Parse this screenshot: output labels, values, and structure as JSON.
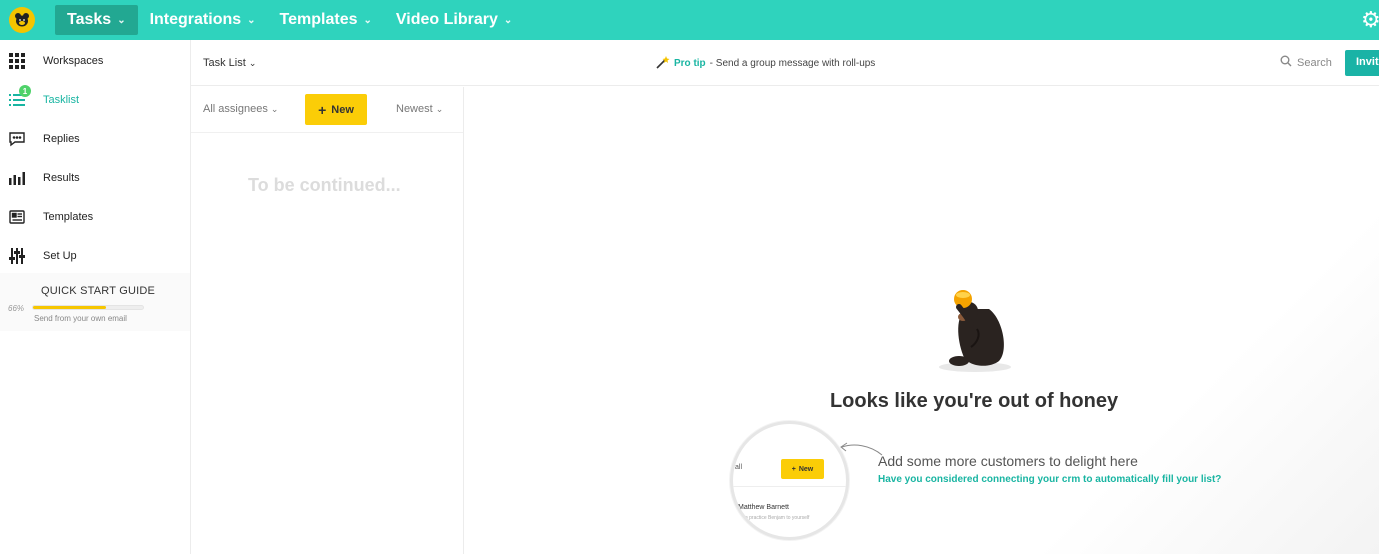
{
  "topbar": {
    "nav": [
      {
        "label": "Tasks",
        "active": true
      },
      {
        "label": "Integrations",
        "active": false
      },
      {
        "label": "Templates",
        "active": false
      },
      {
        "label": "Video Library",
        "active": false
      }
    ]
  },
  "sidebar": {
    "items": [
      {
        "label": "Workspaces",
        "icon": "grid-icon"
      },
      {
        "label": "Tasklist",
        "icon": "list-icon",
        "badge": "1",
        "active": true
      },
      {
        "label": "Replies",
        "icon": "chat-bubble-icon"
      },
      {
        "label": "Results",
        "icon": "bar-chart-icon"
      },
      {
        "label": "Templates",
        "icon": "template-card-icon"
      },
      {
        "label": "Set Up",
        "icon": "sliders-icon"
      }
    ],
    "quick_start": {
      "title": "QUICK START GUIDE",
      "percent_label": "66%",
      "progress": 0.66,
      "subtitle": "Send from your own email"
    }
  },
  "subbar": {
    "tasklist_label": "Task List",
    "protip_label": "Pro tip",
    "protip_text": "- Send a group message with roll-ups",
    "search_label": "Search",
    "invite_label": "Invit"
  },
  "list": {
    "assignees_label": "All assignees",
    "new_label": "New",
    "sort_label": "Newest",
    "empty_text": "To be continued..."
  },
  "main": {
    "title": "Looks like you're out of honey",
    "hint": "Add some more customers to delight here",
    "link": "Have you considered connecting your crm to automatically fill your list?",
    "magnifier": {
      "all_label": "all",
      "new_label": "New",
      "name": "Matthew Barnett",
      "line": "nd a practice Benjam to yourself"
    }
  },
  "colors": {
    "brand_teal": "#2fd3bd",
    "accent_yellow": "#fbcd07",
    "link_teal": "#19b5a2"
  }
}
